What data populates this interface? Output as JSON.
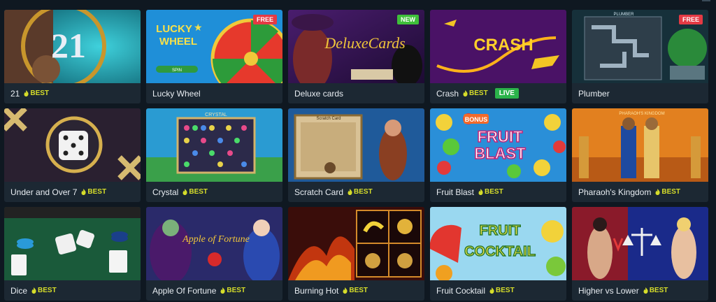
{
  "games": [
    {
      "title": "21",
      "best": "BEST",
      "badge": "",
      "live": ""
    },
    {
      "title": "Lucky Wheel",
      "best": "",
      "badge": "FREE",
      "live": "",
      "art": {
        "line1": "LUCKY",
        "line2": "WHEEL",
        "spin": "SPIN"
      }
    },
    {
      "title": "Deluxe cards",
      "best": "",
      "badge": "NEW",
      "live": "",
      "art": {
        "logo": "DeluxeCards"
      }
    },
    {
      "title": "Crash",
      "best": "BEST",
      "badge": "",
      "live": "LIVE",
      "art": {
        "logo": "CRASH"
      }
    },
    {
      "title": "Plumber",
      "best": "",
      "badge": "FREE",
      "live": "",
      "art": {
        "logo": "PLUMBER"
      }
    },
    {
      "title": "Under and Over 7",
      "best": "BEST",
      "badge": "",
      "live": ""
    },
    {
      "title": "Crystal",
      "best": "BEST",
      "badge": "",
      "live": "",
      "art": {
        "logo": "CRYSTAL"
      }
    },
    {
      "title": "Scratch Card",
      "best": "BEST",
      "badge": "",
      "live": "",
      "art": {
        "logo": "Scratch Card"
      }
    },
    {
      "title": "Fruit Blast",
      "best": "BEST",
      "badge": "",
      "live": "",
      "art": {
        "bonus": "BONUS",
        "line1": "FRUIT",
        "line2": "BLAST"
      }
    },
    {
      "title": "Pharaoh's Kingdom",
      "best": "BEST",
      "badge": "",
      "live": "",
      "art": {
        "logo": "PHARAOH'S KINGDOM"
      }
    },
    {
      "title": "Dice",
      "best": "BEST",
      "badge": "",
      "live": ""
    },
    {
      "title": "Apple Of Fortune",
      "best": "BEST",
      "badge": "",
      "live": "",
      "art": {
        "logo": "Apple of Fortune"
      }
    },
    {
      "title": "Burning Hot",
      "best": "BEST",
      "badge": "",
      "live": ""
    },
    {
      "title": "Fruit Cocktail",
      "best": "BEST",
      "badge": "",
      "live": "",
      "art": {
        "line1": "FRUIT",
        "line2": "COCKTAIL"
      }
    },
    {
      "title": "Higher vs Lower",
      "best": "BEST",
      "badge": "",
      "live": ""
    }
  ],
  "thumb_21": "21",
  "colors": {
    "best": "#d6dd2a",
    "live": "#2bb34a",
    "free": "#e43a44",
    "new": "#3fbf3a",
    "card": "#1c2833",
    "bg": "#0f1821"
  }
}
